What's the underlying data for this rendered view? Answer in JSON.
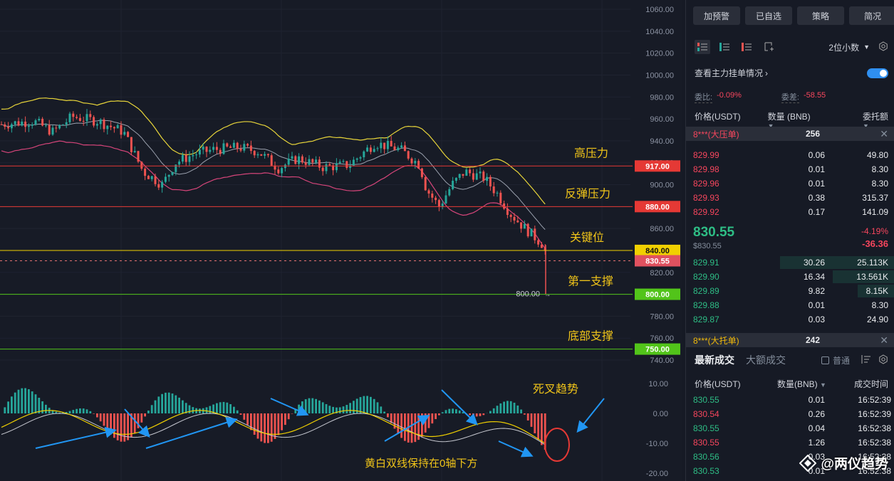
{
  "chart": {
    "price_axis": [
      "1060.00",
      "1040.00",
      "1020.00",
      "1000.00",
      "980.00",
      "960.00",
      "940.00",
      "920.00",
      "900.00",
      "880.00",
      "860.00",
      "840.00",
      "820.00",
      "800.00",
      "780.00",
      "760.00",
      "740.00"
    ],
    "macd_axis": [
      "10.00",
      "0.00",
      "-10.00",
      "-20.00"
    ],
    "levels": [
      {
        "tag": "917.00",
        "label": "高压力",
        "line": "#e53935",
        "tag_bg": "#e53935",
        "tag_fg": "#ffffff",
        "label_color": "#f0c419"
      },
      {
        "tag": "880.00",
        "label": "反弹压力",
        "line": "#e53935",
        "tag_bg": "#e53935",
        "tag_fg": "#ffffff",
        "label_color": "#f0c419"
      },
      {
        "tag": "840.00",
        "label": "关键位",
        "line": "#f0d000",
        "tag_bg": "#f0d000",
        "tag_fg": "#111111",
        "label_color": "#f0c419"
      },
      {
        "tag": "800.00",
        "label": "第一支撑",
        "line": "#52c41a",
        "tag_bg": "#52c41a",
        "tag_fg": "#ffffff",
        "label_color": "#f0c419"
      },
      {
        "tag": "750.00",
        "label": "底部支撑",
        "line": "#52c41a",
        "tag_bg": "#52c41a",
        "tag_fg": "#ffffff",
        "label_color": "#f0c419"
      }
    ],
    "current_price_tag": "830.55",
    "low_marker": "800.00",
    "annotations": {
      "death_cross": "死叉趋势",
      "macd_note": "黄白双线保持在0轴下方"
    },
    "colors": {
      "up": "#26a69a",
      "down": "#ef5350",
      "upper_band": "#e8d53a",
      "lower_band": "#d6457a",
      "mid_band": "#9aa0ad",
      "arrow": "#2196f3"
    }
  },
  "panel": {
    "buttons": [
      "加预警",
      "已自选",
      "策略",
      "简况"
    ],
    "decimals": "2位小数",
    "view_main": "查看主力挂单情况",
    "ratio_label": "委比:",
    "ratio_value": "-0.09%",
    "diff_label": "委差:",
    "diff_value": "-58.55",
    "headers": {
      "price": "价格(USDT)",
      "qty": "数量 (BNB)",
      "total": "委托额"
    },
    "big_ask": {
      "tag": "8***(大压单)",
      "qty": "256"
    },
    "asks": [
      {
        "p": "829.99",
        "q": "0.06",
        "t": "49.80"
      },
      {
        "p": "829.98",
        "q": "0.01",
        "t": "8.30"
      },
      {
        "p": "829.96",
        "q": "0.01",
        "t": "8.30"
      },
      {
        "p": "829.93",
        "q": "0.38",
        "t": "315.37"
      },
      {
        "p": "829.92",
        "q": "0.17",
        "t": "141.09"
      }
    ],
    "last": {
      "price": "830.55",
      "usd": "$830.55",
      "pct": "-4.19%",
      "chg": "-36.36"
    },
    "bids": [
      {
        "p": "829.91",
        "q": "30.26",
        "t": "25.113K",
        "fill": 1.0
      },
      {
        "p": "829.90",
        "q": "16.34",
        "t": "13.561K",
        "fill": 0.54
      },
      {
        "p": "829.89",
        "q": "9.82",
        "t": "8.15K",
        "fill": 0.32
      },
      {
        "p": "829.88",
        "q": "0.01",
        "t": "8.30",
        "fill": 0.0
      },
      {
        "p": "829.87",
        "q": "0.03",
        "t": "24.90",
        "fill": 0.0
      }
    ],
    "big_bid": {
      "tag": "8***(大托单)",
      "qty": "242"
    },
    "trades_tabs": {
      "latest": "最新成交",
      "large": "大额成交",
      "normal": "普通"
    },
    "trade_headers": {
      "price": "价格(USDT)",
      "qty": "数量(BNB)",
      "time": "成交时间"
    },
    "trades": [
      {
        "p": "830.55",
        "q": "0.01",
        "t": "16:52:39",
        "side": "buy"
      },
      {
        "p": "830.54",
        "q": "0.26",
        "t": "16:52:39",
        "side": "sell"
      },
      {
        "p": "830.55",
        "q": "0.04",
        "t": "16:52:38",
        "side": "buy"
      },
      {
        "p": "830.55",
        "q": "1.26",
        "t": "16:52:38",
        "side": "sell"
      },
      {
        "p": "830.56",
        "q": "0.03",
        "t": "16:52:38",
        "side": "buy"
      },
      {
        "p": "830.53",
        "q": "0.01",
        "t": "16:52:38",
        "side": "buy"
      }
    ],
    "watermark": "@两仪趋势"
  }
}
